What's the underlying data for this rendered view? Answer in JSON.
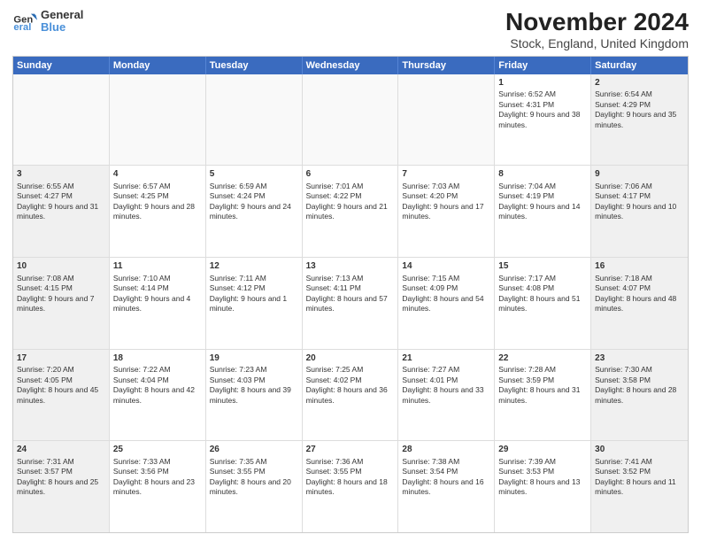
{
  "logo": {
    "line1": "General",
    "line2": "Blue"
  },
  "title": "November 2024",
  "subtitle": "Stock, England, United Kingdom",
  "days": [
    "Sunday",
    "Monday",
    "Tuesday",
    "Wednesday",
    "Thursday",
    "Friday",
    "Saturday"
  ],
  "weeks": [
    [
      {
        "day": "",
        "empty": true
      },
      {
        "day": "",
        "empty": true
      },
      {
        "day": "",
        "empty": true
      },
      {
        "day": "",
        "empty": true
      },
      {
        "day": "",
        "empty": true
      },
      {
        "day": "1",
        "sunrise": "Sunrise: 6:52 AM",
        "sunset": "Sunset: 4:31 PM",
        "daylight": "Daylight: 9 hours and 38 minutes."
      },
      {
        "day": "2",
        "sunrise": "Sunrise: 6:54 AM",
        "sunset": "Sunset: 4:29 PM",
        "daylight": "Daylight: 9 hours and 35 minutes."
      }
    ],
    [
      {
        "day": "3",
        "sunrise": "Sunrise: 6:55 AM",
        "sunset": "Sunset: 4:27 PM",
        "daylight": "Daylight: 9 hours and 31 minutes."
      },
      {
        "day": "4",
        "sunrise": "Sunrise: 6:57 AM",
        "sunset": "Sunset: 4:25 PM",
        "daylight": "Daylight: 9 hours and 28 minutes."
      },
      {
        "day": "5",
        "sunrise": "Sunrise: 6:59 AM",
        "sunset": "Sunset: 4:24 PM",
        "daylight": "Daylight: 9 hours and 24 minutes."
      },
      {
        "day": "6",
        "sunrise": "Sunrise: 7:01 AM",
        "sunset": "Sunset: 4:22 PM",
        "daylight": "Daylight: 9 hours and 21 minutes."
      },
      {
        "day": "7",
        "sunrise": "Sunrise: 7:03 AM",
        "sunset": "Sunset: 4:20 PM",
        "daylight": "Daylight: 9 hours and 17 minutes."
      },
      {
        "day": "8",
        "sunrise": "Sunrise: 7:04 AM",
        "sunset": "Sunset: 4:19 PM",
        "daylight": "Daylight: 9 hours and 14 minutes."
      },
      {
        "day": "9",
        "sunrise": "Sunrise: 7:06 AM",
        "sunset": "Sunset: 4:17 PM",
        "daylight": "Daylight: 9 hours and 10 minutes."
      }
    ],
    [
      {
        "day": "10",
        "sunrise": "Sunrise: 7:08 AM",
        "sunset": "Sunset: 4:15 PM",
        "daylight": "Daylight: 9 hours and 7 minutes."
      },
      {
        "day": "11",
        "sunrise": "Sunrise: 7:10 AM",
        "sunset": "Sunset: 4:14 PM",
        "daylight": "Daylight: 9 hours and 4 minutes."
      },
      {
        "day": "12",
        "sunrise": "Sunrise: 7:11 AM",
        "sunset": "Sunset: 4:12 PM",
        "daylight": "Daylight: 9 hours and 1 minute."
      },
      {
        "day": "13",
        "sunrise": "Sunrise: 7:13 AM",
        "sunset": "Sunset: 4:11 PM",
        "daylight": "Daylight: 8 hours and 57 minutes."
      },
      {
        "day": "14",
        "sunrise": "Sunrise: 7:15 AM",
        "sunset": "Sunset: 4:09 PM",
        "daylight": "Daylight: 8 hours and 54 minutes."
      },
      {
        "day": "15",
        "sunrise": "Sunrise: 7:17 AM",
        "sunset": "Sunset: 4:08 PM",
        "daylight": "Daylight: 8 hours and 51 minutes."
      },
      {
        "day": "16",
        "sunrise": "Sunrise: 7:18 AM",
        "sunset": "Sunset: 4:07 PM",
        "daylight": "Daylight: 8 hours and 48 minutes."
      }
    ],
    [
      {
        "day": "17",
        "sunrise": "Sunrise: 7:20 AM",
        "sunset": "Sunset: 4:05 PM",
        "daylight": "Daylight: 8 hours and 45 minutes."
      },
      {
        "day": "18",
        "sunrise": "Sunrise: 7:22 AM",
        "sunset": "Sunset: 4:04 PM",
        "daylight": "Daylight: 8 hours and 42 minutes."
      },
      {
        "day": "19",
        "sunrise": "Sunrise: 7:23 AM",
        "sunset": "Sunset: 4:03 PM",
        "daylight": "Daylight: 8 hours and 39 minutes."
      },
      {
        "day": "20",
        "sunrise": "Sunrise: 7:25 AM",
        "sunset": "Sunset: 4:02 PM",
        "daylight": "Daylight: 8 hours and 36 minutes."
      },
      {
        "day": "21",
        "sunrise": "Sunrise: 7:27 AM",
        "sunset": "Sunset: 4:01 PM",
        "daylight": "Daylight: 8 hours and 33 minutes."
      },
      {
        "day": "22",
        "sunrise": "Sunrise: 7:28 AM",
        "sunset": "Sunset: 3:59 PM",
        "daylight": "Daylight: 8 hours and 31 minutes."
      },
      {
        "day": "23",
        "sunrise": "Sunrise: 7:30 AM",
        "sunset": "Sunset: 3:58 PM",
        "daylight": "Daylight: 8 hours and 28 minutes."
      }
    ],
    [
      {
        "day": "24",
        "sunrise": "Sunrise: 7:31 AM",
        "sunset": "Sunset: 3:57 PM",
        "daylight": "Daylight: 8 hours and 25 minutes."
      },
      {
        "day": "25",
        "sunrise": "Sunrise: 7:33 AM",
        "sunset": "Sunset: 3:56 PM",
        "daylight": "Daylight: 8 hours and 23 minutes."
      },
      {
        "day": "26",
        "sunrise": "Sunrise: 7:35 AM",
        "sunset": "Sunset: 3:55 PM",
        "daylight": "Daylight: 8 hours and 20 minutes."
      },
      {
        "day": "27",
        "sunrise": "Sunrise: 7:36 AM",
        "sunset": "Sunset: 3:55 PM",
        "daylight": "Daylight: 8 hours and 18 minutes."
      },
      {
        "day": "28",
        "sunrise": "Sunrise: 7:38 AM",
        "sunset": "Sunset: 3:54 PM",
        "daylight": "Daylight: 8 hours and 16 minutes."
      },
      {
        "day": "29",
        "sunrise": "Sunrise: 7:39 AM",
        "sunset": "Sunset: 3:53 PM",
        "daylight": "Daylight: 8 hours and 13 minutes."
      },
      {
        "day": "30",
        "sunrise": "Sunrise: 7:41 AM",
        "sunset": "Sunset: 3:52 PM",
        "daylight": "Daylight: 8 hours and 11 minutes."
      }
    ]
  ]
}
